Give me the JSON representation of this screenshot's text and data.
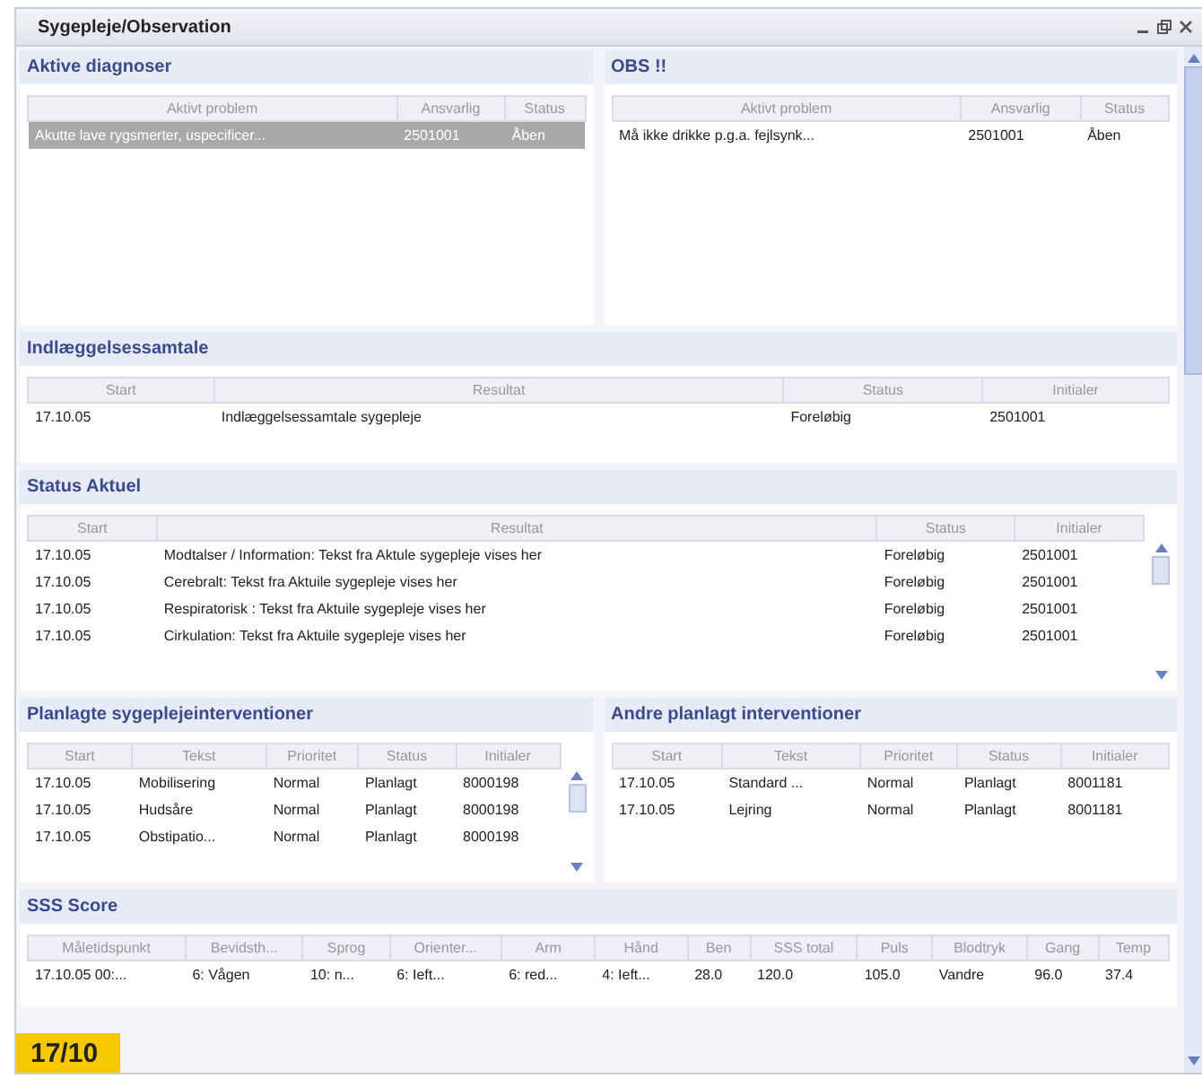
{
  "window": {
    "title": "Sygepleje/Observation"
  },
  "panel_rows": [
    [
      {
        "title": "Aktive diagnoser",
        "scrollable": false,
        "columns": [
          "Aktivt problem",
          "Ansvarlig",
          "Status"
        ],
        "rows": [
          {
            "cells": [
              "Akutte lave rygsmerter, uspecificer...",
              "2501001",
              "Åben"
            ],
            "selected": true
          }
        ]
      },
      {
        "title": "OBS !!",
        "scrollable": false,
        "columns": [
          "Aktivt problem",
          "Ansvarlig",
          "Status"
        ],
        "rows": [
          {
            "cells": [
              "Må ikke drikke p.g.a. fejlsynk...",
              "2501001",
              "Åben"
            ],
            "selected": false
          }
        ]
      }
    ],
    [
      {
        "title": "Indlæggelsessamtale",
        "scrollable": false,
        "columns": [
          "Start",
          "Resultat",
          "Status",
          "Initialer"
        ],
        "rows": [
          {
            "cells": [
              "17.10.05",
              "Indlæggelsessamtale sygepleje",
              "Foreløbig",
              "2501001"
            ],
            "selected": false
          }
        ]
      }
    ],
    [
      {
        "title": "Status Aktuel",
        "scrollable": true,
        "columns": [
          "Start",
          "Resultat",
          "Status",
          "Initialer"
        ],
        "rows": [
          {
            "cells": [
              "17.10.05",
              "Modtalser / Information: Tekst fra Aktule sygepleje vises her",
              "Foreløbig",
              "2501001"
            ],
            "selected": false
          },
          {
            "cells": [
              "17.10.05",
              "Cerebralt: Tekst fra Aktuile sygepleje vises her",
              "Foreløbig",
              "2501001"
            ],
            "selected": false
          },
          {
            "cells": [
              "17.10.05",
              "Respiratorisk : Tekst fra Aktuile sygepleje vises her",
              "Foreløbig",
              "2501001"
            ],
            "selected": false
          },
          {
            "cells": [
              "17.10.05",
              "Cirkulation: Tekst fra Aktuile sygepleje vises her",
              "Foreløbig",
              "2501001"
            ],
            "selected": false
          }
        ]
      }
    ],
    [
      {
        "title": "Planlagte sygeplejeinterventioner",
        "scrollable": true,
        "columns": [
          "Start",
          "Tekst",
          "Prioritet",
          "Status",
          "Initialer"
        ],
        "rows": [
          {
            "cells": [
              "17.10.05",
              "Mobilisering",
              "Normal",
              "Planlagt",
              "8000198"
            ],
            "selected": false
          },
          {
            "cells": [
              "17.10.05",
              "Hudsåre",
              "Normal",
              "Planlagt",
              "8000198"
            ],
            "selected": false
          },
          {
            "cells": [
              "17.10.05",
              "Obstipatio...",
              "Normal",
              "Planlagt",
              "8000198"
            ],
            "selected": false
          }
        ]
      },
      {
        "title": "Andre planlagt interventioner",
        "scrollable": false,
        "columns": [
          "Start",
          "Tekst",
          "Prioritet",
          "Status",
          "Initialer"
        ],
        "rows": [
          {
            "cells": [
              "17.10.05",
              "Standard ...",
              "Normal",
              "Planlagt",
              "8001181"
            ],
            "selected": false
          },
          {
            "cells": [
              "17.10.05",
              "Lejring",
              "Normal",
              "Planlagt",
              "8001181"
            ],
            "selected": false
          }
        ]
      }
    ],
    [
      {
        "title": "SSS Score",
        "scrollable": false,
        "columns": [
          "Måletidspunkt",
          "Bevidsth...",
          "Sprog",
          "Orienter...",
          "Arm",
          "Hånd",
          "Ben",
          "SSS total",
          "Puls",
          "Blodtryk",
          "Gang",
          "Temp"
        ],
        "rows": [
          {
            "cells": [
              "17.10.05 00:...",
              "6: Vågen",
              "10: n...",
              "6: Ieft...",
              "6: red...",
              "4: Ieft...",
              "28.0",
              "120.0",
              "105.0",
              "Vandre",
              "96.0",
              "37.4"
            ],
            "selected": false
          }
        ]
      }
    ]
  ],
  "date_badge": "17/10"
}
